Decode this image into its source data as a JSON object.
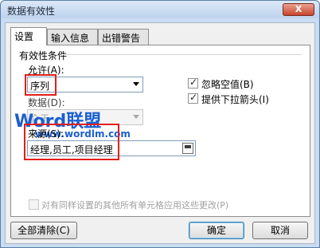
{
  "window": {
    "title": "数据有效性",
    "close_label": "X"
  },
  "tabs": [
    {
      "label": "设置"
    },
    {
      "label": "输入信息"
    },
    {
      "label": "出错警告"
    }
  ],
  "settings": {
    "section_title": "有效性条件",
    "allow_label": "允许(A):",
    "allow_value": "序列",
    "data_label": "数据(D):",
    "data_value": "介于",
    "ignore_blank_label": "忽略空值(B)",
    "ignore_blank_checked": true,
    "dropdown_label": "提供下拉箭头(I)",
    "dropdown_checked": true,
    "source_label": "来源(S):",
    "source_value": "经理,员工,项目经理",
    "apply_all_label": "对有同样设置的其他所有单元格应用这些更改(P)",
    "apply_all_checked": false
  },
  "watermark": {
    "brand_text": "Word联盟",
    "url_text": "www.wordlm.com",
    "blue": "#1a5fd1",
    "red": "#e0201a"
  },
  "buttons": {
    "clear_all": "全部清除(C)",
    "ok": "确定",
    "cancel": "取消"
  },
  "colors": {
    "highlight_red": "#e0201a",
    "title_bar": "#c9dcf2"
  }
}
